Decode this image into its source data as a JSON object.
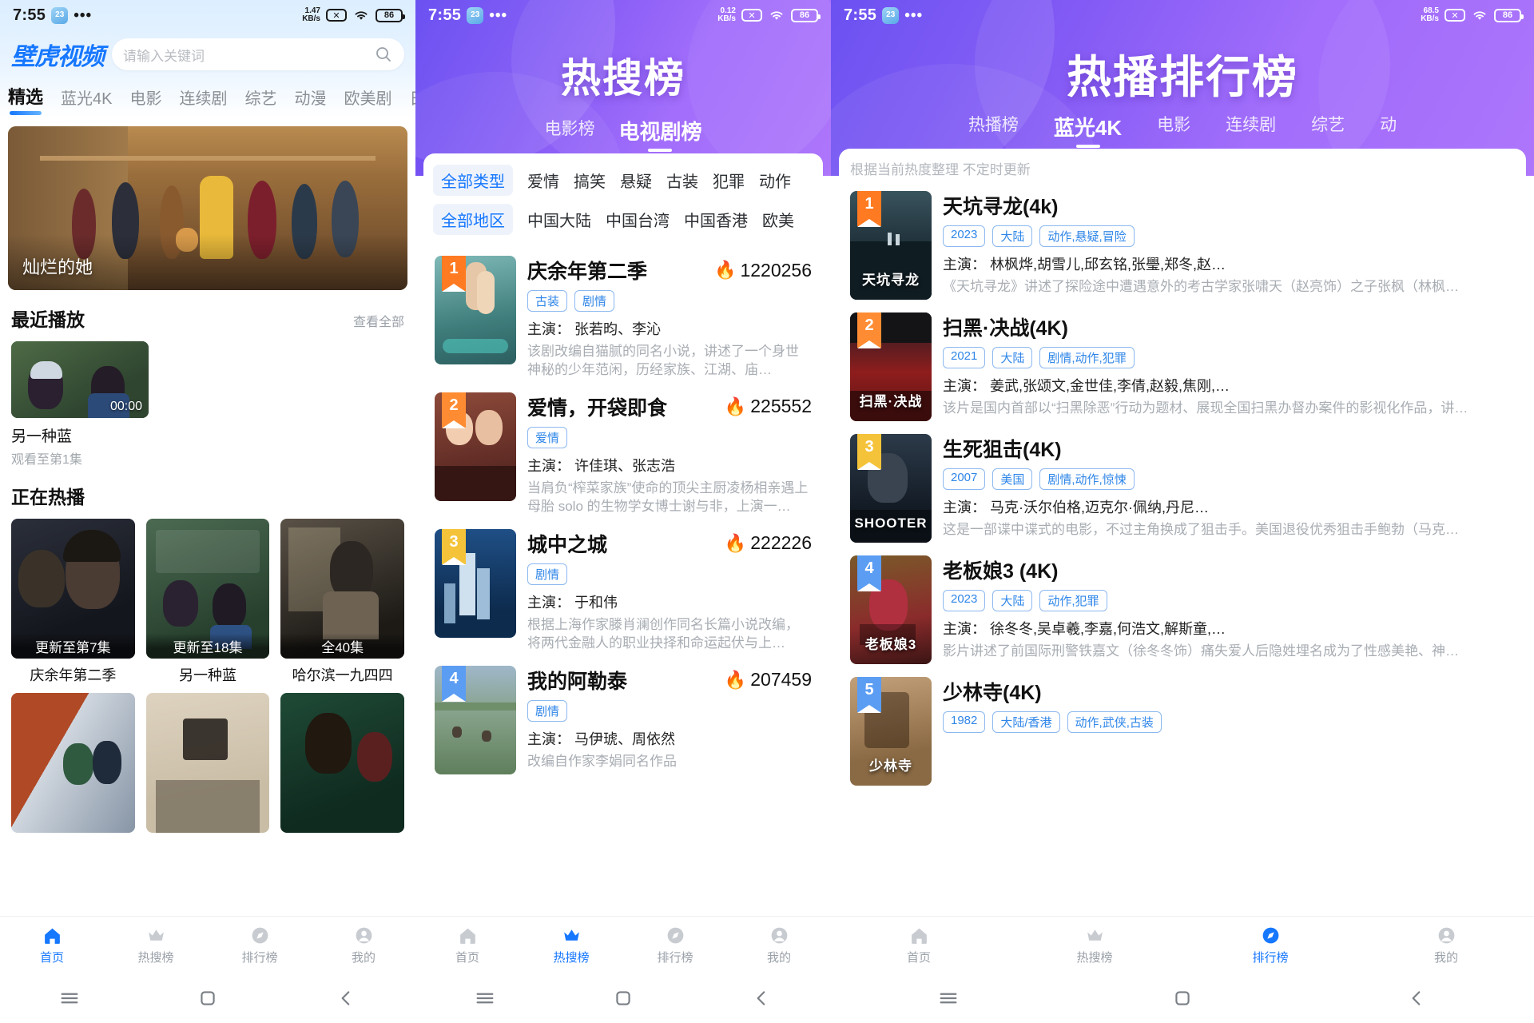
{
  "status_bar": {
    "time": "7:55",
    "app_badge": "23",
    "dots": "•••",
    "net_1": "1.47\nKB/s",
    "net_1_a": "1.47",
    "net_1_b": "KB/s",
    "net_2_a": "0.12",
    "net_2_b": "KB/s",
    "net_3_a": "68.5",
    "net_3_b": "KB/s",
    "x_icon": "✕",
    "battery": "86"
  },
  "screen1": {
    "logo": "壁虎视频",
    "search": {
      "placeholder": "请输入关键词",
      "icon": "search-icon"
    },
    "tabs": [
      {
        "label": "精选",
        "active": true
      },
      {
        "label": "蓝光4K",
        "active": false
      },
      {
        "label": "电影",
        "active": false
      },
      {
        "label": "连续剧",
        "active": false
      },
      {
        "label": "综艺",
        "active": false
      },
      {
        "label": "动漫",
        "active": false
      },
      {
        "label": "欧美剧",
        "active": false
      },
      {
        "label": "日韩",
        "active": false
      }
    ],
    "banner": {
      "title": "灿烂的她"
    },
    "recent_section": {
      "title": "最近播放",
      "more": "查看全部"
    },
    "recent_item": {
      "title": "另一种蓝",
      "subtitle": "观看至第1集",
      "duration": "00:00"
    },
    "hot_section": {
      "title": "正在热播"
    },
    "hot_cards": [
      {
        "title": "庆余年第二季",
        "badge": "更新至第7集"
      },
      {
        "title": "另一种蓝",
        "badge": "更新至18集"
      },
      {
        "title": "哈尔滨一九四四",
        "badge": "全40集"
      },
      {
        "title": "",
        "badge": ""
      },
      {
        "title": "",
        "badge": ""
      },
      {
        "title": "",
        "badge": ""
      }
    ],
    "bottom_nav": [
      {
        "label": "首页",
        "icon": "home-icon",
        "active": true
      },
      {
        "label": "热搜榜",
        "icon": "crown-icon",
        "active": false
      },
      {
        "label": "排行榜",
        "icon": "compass-icon",
        "active": false
      },
      {
        "label": "我的",
        "icon": "person-icon",
        "active": false
      }
    ]
  },
  "screen2": {
    "title": "热搜榜",
    "tabs": [
      {
        "label": "电影榜",
        "active": false
      },
      {
        "label": "电视剧榜",
        "active": true
      }
    ],
    "filter_type": [
      "全部类型",
      "爱情",
      "搞笑",
      "悬疑",
      "古装",
      "犯罪",
      "动作"
    ],
    "filter_region": [
      "全部地区",
      "中国大陆",
      "中国台湾",
      "中国香港",
      "欧美"
    ],
    "items": [
      {
        "rank": "1",
        "title": "庆余年第二季",
        "hot": "1220256",
        "tags": [
          "古装",
          "剧情"
        ],
        "cast": "主演： 张若昀、李沁",
        "desc": "该剧改编自猫腻的同名小说，讲述了一个身世神秘的少年范闲，历经家族、江湖、庙…"
      },
      {
        "rank": "2",
        "title": "爱情，开袋即食",
        "hot": "225552",
        "tags": [
          "爱情"
        ],
        "cast": "主演： 许佳琪、张志浩",
        "desc": "当肩负“榨菜家族”使命的顶尖主厨凌杨相亲遇上母胎 solo 的生物学女博士谢与非，上演一…"
      },
      {
        "rank": "3",
        "title": "城中之城",
        "hot": "222226",
        "tags": [
          "剧情"
        ],
        "cast": "主演： 于和伟",
        "desc": "根据上海作家滕肖澜创作同名长篇小说改编，将两代金融人的职业抉择和命运起伏与上…"
      },
      {
        "rank": "4",
        "title": "我的阿勒泰",
        "hot": "207459",
        "tags": [
          "剧情"
        ],
        "cast": "主演： 马伊琥、周依然",
        "desc": "改编自作家李娟同名作品"
      }
    ],
    "bottom_nav": [
      {
        "label": "首页",
        "icon": "home-icon",
        "active": false
      },
      {
        "label": "热搜榜",
        "icon": "crown-icon",
        "active": true
      },
      {
        "label": "排行榜",
        "icon": "compass-icon",
        "active": false
      },
      {
        "label": "我的",
        "icon": "person-icon",
        "active": false
      }
    ]
  },
  "screen3": {
    "title": "热播排行榜",
    "tabs": [
      {
        "label": "热播榜",
        "active": false
      },
      {
        "label": "蓝光4K",
        "active": true
      },
      {
        "label": "电影",
        "active": false
      },
      {
        "label": "连续剧",
        "active": false
      },
      {
        "label": "综艺",
        "active": false
      },
      {
        "label": "动",
        "active": false
      }
    ],
    "note": "根据当前热度整理 不定时更新",
    "items": [
      {
        "rank": "1",
        "title": "天坑寻龙(4k)",
        "tags": [
          "2023",
          "大陆",
          "动作,悬疑,冒险"
        ],
        "cast": "主演： 林枫烨,胡雪儿,邱玄铭,张璺,郑冬,赵…",
        "desc": "《天坑寻龙》讲述了探险途中遭遇意外的考古学家张啸天（赵亮饰）之子张枫（林枫…"
      },
      {
        "rank": "2",
        "title": "扫黑·决战(4K)",
        "tags": [
          "2021",
          "大陆",
          "剧情,动作,犯罪"
        ],
        "cast": "主演： 姜武,张颂文,金世佳,李倩,赵毅,焦刚,…",
        "desc": "该片是国内首部以“扫黑除恶”行动为题材、展现全国扫黑办督办案件的影视化作品，讲…"
      },
      {
        "rank": "3",
        "title": "生死狙击(4K)",
        "tags": [
          "2007",
          "美国",
          "剧情,动作,惊悚"
        ],
        "cast": "主演： 马克·沃尔伯格,迈克尔·佩纳,丹尼…",
        "desc": "这是一部谍中谍式的电影，不过主角换成了狙击手。美国退役优秀狙击手鲍勃（马克…"
      },
      {
        "rank": "4",
        "title": "老板娘3 (4K)",
        "tags": [
          "2023",
          "大陆",
          "动作,犯罪"
        ],
        "cast": "主演： 徐冬冬,吴卓羲,李嘉,何浩文,解斯童,…",
        "desc": "影片讲述了前国际刑警铁嘉文（徐冬冬饰）痛失爱人后隐姓埋名成为了性感美艳、神…"
      },
      {
        "rank": "5",
        "title": "少林寺(4K)",
        "tags": [
          "1982",
          "大陆/香港",
          "动作,武侠,古装"
        ],
        "cast": "",
        "desc": ""
      }
    ],
    "bottom_nav": [
      {
        "label": "首页",
        "icon": "home-icon",
        "active": false
      },
      {
        "label": "热搜榜",
        "icon": "crown-icon",
        "active": false
      },
      {
        "label": "排行榜",
        "icon": "compass-icon",
        "active": true
      },
      {
        "label": "我的",
        "icon": "person-icon",
        "active": false
      }
    ]
  },
  "system_nav": {
    "menu": "menu-icon",
    "home": "home-square-icon",
    "back": "back-icon"
  }
}
